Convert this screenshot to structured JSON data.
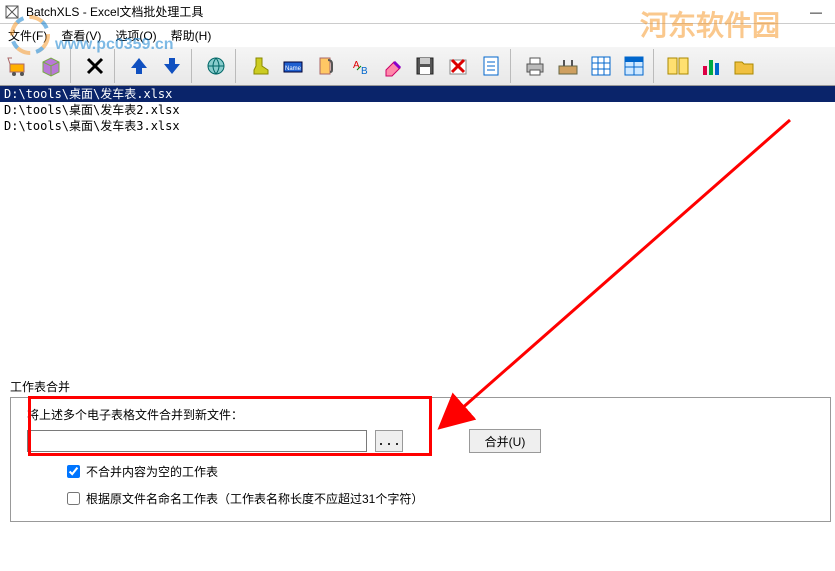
{
  "window": {
    "title": "BatchXLS - Excel文档批处理工具",
    "minimize": "—"
  },
  "menu": {
    "file": "文件(F)",
    "view": "查看(V)",
    "options": "选项(O)",
    "help": "帮助(H)"
  },
  "files": [
    "D:\\tools\\桌面\\发车表.xlsx",
    "D:\\tools\\桌面\\发车表2.xlsx",
    "D:\\tools\\桌面\\发车表3.xlsx"
  ],
  "panel": {
    "group_label": "工作表合并",
    "prompt": "将上述多个电子表格文件合并到新文件：",
    "path_value": "",
    "browse": "...",
    "merge_btn": "合并(U)",
    "chk_skip_empty": "不合并内容为空的工作表",
    "chk_rename": "根据原文件名命名工作表（工作表名称长度不应超过31个字符）"
  },
  "watermark": {
    "text_cn": "河东软件园",
    "url": "www.pc0359.cn"
  }
}
